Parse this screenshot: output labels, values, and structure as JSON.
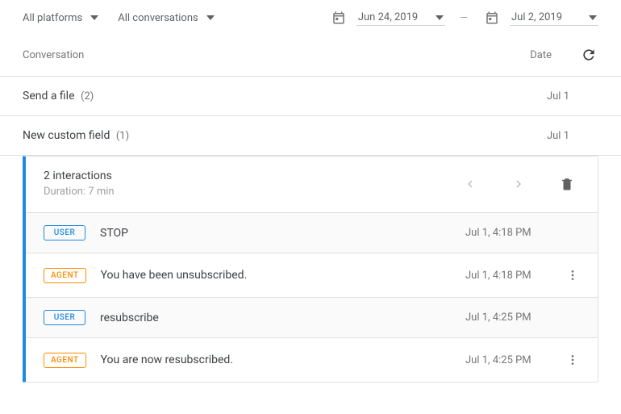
{
  "filters": {
    "platform": "All platforms",
    "conversation_filter": "All conversations",
    "start_date": "Jun 24, 2019",
    "end_date": "Jul 2, 2019"
  },
  "table": {
    "conversation_header": "Conversation",
    "date_header": "Date"
  },
  "rows": [
    {
      "title": "Send a file",
      "count": "(2)",
      "date": "Jul 1"
    },
    {
      "title": "New custom field",
      "count": "(1)",
      "date": "Jul 1"
    }
  ],
  "expanded": {
    "summary": "2 interactions",
    "duration": "Duration: 7 min",
    "interactions": [
      {
        "role": "USER",
        "role_class": "user",
        "text": "STOP",
        "time": "Jul 1, 4:18 PM",
        "has_menu": false
      },
      {
        "role": "AGENT",
        "role_class": "agent",
        "text": "You have been unsubscribed.",
        "time": "Jul 1, 4:18 PM",
        "has_menu": true
      },
      {
        "role": "USER",
        "role_class": "user",
        "text": "resubscribe",
        "time": "Jul 1, 4:25 PM",
        "has_menu": false
      },
      {
        "role": "AGENT",
        "role_class": "agent",
        "text": "You are now resubscribed.",
        "time": "Jul 1, 4:25 PM",
        "has_menu": true
      }
    ]
  }
}
